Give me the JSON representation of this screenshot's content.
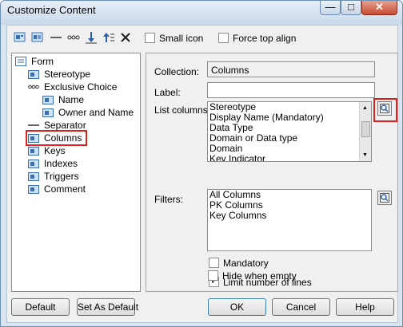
{
  "window": {
    "title": "Customize Content"
  },
  "title_buttons": {
    "minimize": "—",
    "maximize": "□",
    "close": "✕"
  },
  "toolbar": {
    "icons": [
      "add-form-icon",
      "add-form-alt-icon",
      "separator-line-icon",
      "exclusive-choice-icon",
      "move-down-icon",
      "move-up-icon",
      "delete-icon"
    ],
    "small_icon": {
      "label": "Small icon",
      "checked": false
    },
    "force_top_align": {
      "label": "Force top align",
      "checked": false
    }
  },
  "tree": {
    "items": [
      {
        "label": "Form",
        "icon": "form-icon",
        "level": 0
      },
      {
        "label": "Stereotype",
        "icon": "folder-icon",
        "level": 1
      },
      {
        "label": "Exclusive Choice",
        "icon": "exclusive-choice-icon",
        "level": 1
      },
      {
        "label": "Name",
        "icon": "folder-icon",
        "level": 2
      },
      {
        "label": "Owner and Name",
        "icon": "folder-icon",
        "level": 2
      },
      {
        "label": "Separator",
        "icon": "separator-icon",
        "level": 1
      },
      {
        "label": "Columns",
        "icon": "folder-icon",
        "level": 1,
        "selected": true
      },
      {
        "label": "Keys",
        "icon": "folder-icon",
        "level": 1
      },
      {
        "label": "Indexes",
        "icon": "folder-icon",
        "level": 1
      },
      {
        "label": "Triggers",
        "icon": "folder-icon",
        "level": 1
      },
      {
        "label": "Comment",
        "icon": "folder-icon",
        "level": 1
      }
    ]
  },
  "props": {
    "collection_label": "Collection:",
    "collection_value": "Columns",
    "label_label": "Label:",
    "label_value": "",
    "list_columns_label": "List columns:",
    "list_columns": [
      "Stereotype",
      "Display Name (Mandatory)",
      "Data Type",
      "Domain or Data type",
      "Domain",
      "Key Indicator"
    ],
    "filters_label": "Filters:",
    "filters": [
      "All Columns",
      "PK Columns",
      "Key Columns"
    ],
    "mandatory": {
      "label": "Mandatory",
      "checked": false
    },
    "limit_lines": {
      "label": "Limit number of lines",
      "checked": true
    },
    "hide_empty": {
      "label": "Hide when empty",
      "checked": false
    },
    "properties_icon": "properties-icon"
  },
  "buttons": {
    "default": "Default",
    "set_as_default": "Set As Default",
    "ok": "OK",
    "cancel": "Cancel",
    "help": "Help"
  },
  "colors": {
    "highlight": "#e0201a",
    "title_bg": "#d8e4f0"
  }
}
